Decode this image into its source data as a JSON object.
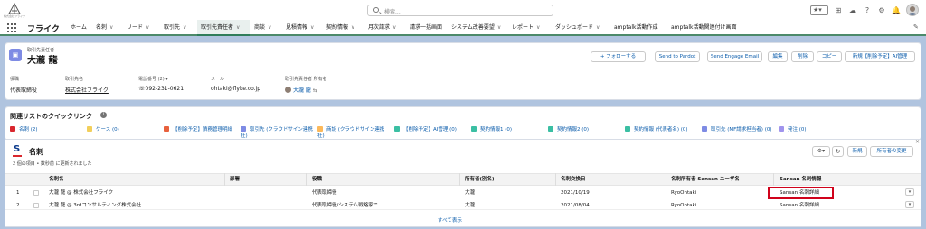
{
  "header": {
    "logo_caption": "株式会社フライク",
    "search_placeholder": "検索...",
    "icons": [
      "star-icon",
      "chevron-down-icon",
      "plus-icon",
      "cloud-icon",
      "help-icon",
      "gear-icon",
      "bell-icon",
      "avatar-icon"
    ]
  },
  "nav": {
    "app_name": "フライク",
    "items": [
      "ホーム",
      "名刺",
      "リード",
      "取引先",
      "取引先責任者",
      "商談",
      "見積情報",
      "契約情報",
      "月次請求",
      "請求一括画面",
      "システム改善要望",
      "レポート",
      "ダッシュボード",
      "amptalk活動作成",
      "amptalk活動関連付け画面"
    ]
  },
  "record": {
    "object_label": "取引先責任者",
    "name": "大瀧 龍",
    "buttons": [
      "+ フォローする",
      "Send to Pardot",
      "Send Engage Email",
      "編集",
      "削除",
      "コピー",
      "新規【削除予定】AI管理"
    ],
    "highlights": [
      {
        "label": "役職",
        "value": "代表取締役"
      },
      {
        "label": "取引先名",
        "value": "株式会社フライク"
      },
      {
        "label": "電話番号 (2)",
        "value": "092-231-0621"
      },
      {
        "label": "メール",
        "value": "ohtaki@flyke.co.jp"
      },
      {
        "label": "取引先責任者 所有者",
        "value": "大瀧 龍"
      }
    ]
  },
  "quick_links": {
    "title": "関連リストのクイックリンク",
    "items": [
      {
        "label": "名刺 (2)",
        "color": "#d9272e"
      },
      {
        "label": "ケース (0)",
        "color": "#f2cf5b"
      },
      {
        "label": "【削除予定】債務管理明細",
        "color": "#e8613d"
      },
      {
        "label": "取引先 (クラウドサイン連携社)",
        "color": "#7e8be4"
      },
      {
        "label": "商談 (クラウドサイン連携社)",
        "color": "#fcb95b"
      },
      {
        "label": "【削除予定】AI管理 (0)",
        "color": "#3bbfa3"
      },
      {
        "label": "契約情報1 (0)",
        "color": "#3bbfa3"
      },
      {
        "label": "契約情報2 (0)",
        "color": "#3bbfa3"
      },
      {
        "label": "契約情報 (代表者名) (0)",
        "color": "#3bbfa3"
      },
      {
        "label": "取引先 (MF請求担当者) (0)",
        "color": "#7e8be4"
      },
      {
        "label": "発注 (0)",
        "color": "#a094ed"
      }
    ]
  },
  "related_list": {
    "title": "名刺",
    "subtitle": "2 個の項目 • 数秒前 に更新されました",
    "buttons": [
      "新規",
      "所有者の変更"
    ],
    "columns": [
      "名刺名",
      "部署",
      "役職",
      "所有者(別名)",
      "名刺交換日",
      "名刺所有者 Sansan ユーザ名",
      "Sansan 名刺情報"
    ],
    "rows": [
      {
        "num": "1",
        "name": "大瀧 龍 @ 株式会社フライク",
        "dept": "",
        "title": "代表取締役",
        "owner": "大瀧",
        "date": "2021/10/19",
        "sansan_user": "RyoOhtaki",
        "sansan_info": "Sansan 名刺詳細"
      },
      {
        "num": "2",
        "name": "大瀧 龍 @ 3rdコンサルティング株式会社",
        "dept": "",
        "title": "代表取締役/システム戦略家™",
        "owner": "大瀧",
        "date": "2021/08/04",
        "sansan_user": "RyoOhtaki",
        "sansan_info": "Sansan 名刺詳細"
      }
    ],
    "show_all": "すべて表示"
  }
}
